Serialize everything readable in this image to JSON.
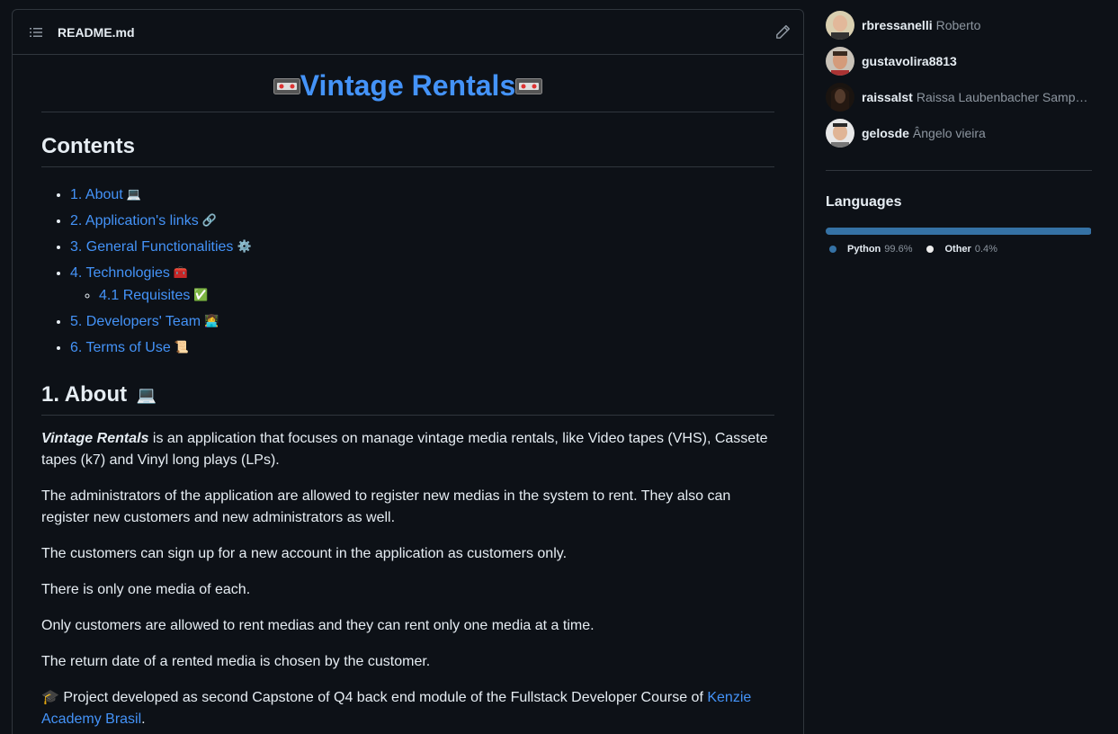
{
  "readme": {
    "filename": "README.md",
    "title": "Vintage Rentals",
    "contents_heading": "Contents",
    "toc": [
      {
        "label": "1. About",
        "emoji": "💻"
      },
      {
        "label": "2. Application's links",
        "emoji": "🔗"
      },
      {
        "label": "3. General Functionalities",
        "emoji": "⚙️"
      },
      {
        "label": "4. Technologies",
        "emoji": "🧰"
      },
      {
        "label": "4.1 Requisites",
        "emoji": "✅"
      },
      {
        "label": "5. Developers' Team",
        "emoji": "👩‍💻"
      },
      {
        "label": "6. Terms of Use",
        "emoji": "📜"
      }
    ],
    "about_heading": "1. About",
    "about_emoji": "💻",
    "p1_strong": "Vintage Rentals",
    "p1_rest": " is an application that focuses on manage vintage media rentals, like Video tapes (VHS), Cassete tapes (k7) and Vinyl long plays (LPs).",
    "p2": "The administrators of the application are allowed to register new medias in the system to rent. They also can register new customers and new administrators as well.",
    "p3": "The customers can sign up for a new account in the application as customers only.",
    "p4": "There is only one media of each.",
    "p5": "Only customers are allowed to rent medias and they can rent only one media at a time.",
    "p6": "The return date of a rented media is chosen by the customer.",
    "p7_prefix": "🎓 Project developed as second Capstone of Q4 back end module of the Fullstack Developer Course of ",
    "p7_link": "Kenzie Academy Brasil",
    "p7_suffix": "."
  },
  "contributors": [
    {
      "login": "rbressanelli",
      "name": "Roberto"
    },
    {
      "login": "gustavolira8813",
      "name": ""
    },
    {
      "login": "raissalst",
      "name": "Raissa Laubenbacher Samp…"
    },
    {
      "login": "gelosde",
      "name": "Ângelo vieira"
    }
  ],
  "languages": {
    "heading": "Languages",
    "items": [
      {
        "name": "Python",
        "percent": "99.6%",
        "value": 99.6,
        "color": "#3572a5"
      },
      {
        "name": "Other",
        "percent": "0.4%",
        "value": 0.4,
        "color": "#ededed"
      }
    ]
  }
}
